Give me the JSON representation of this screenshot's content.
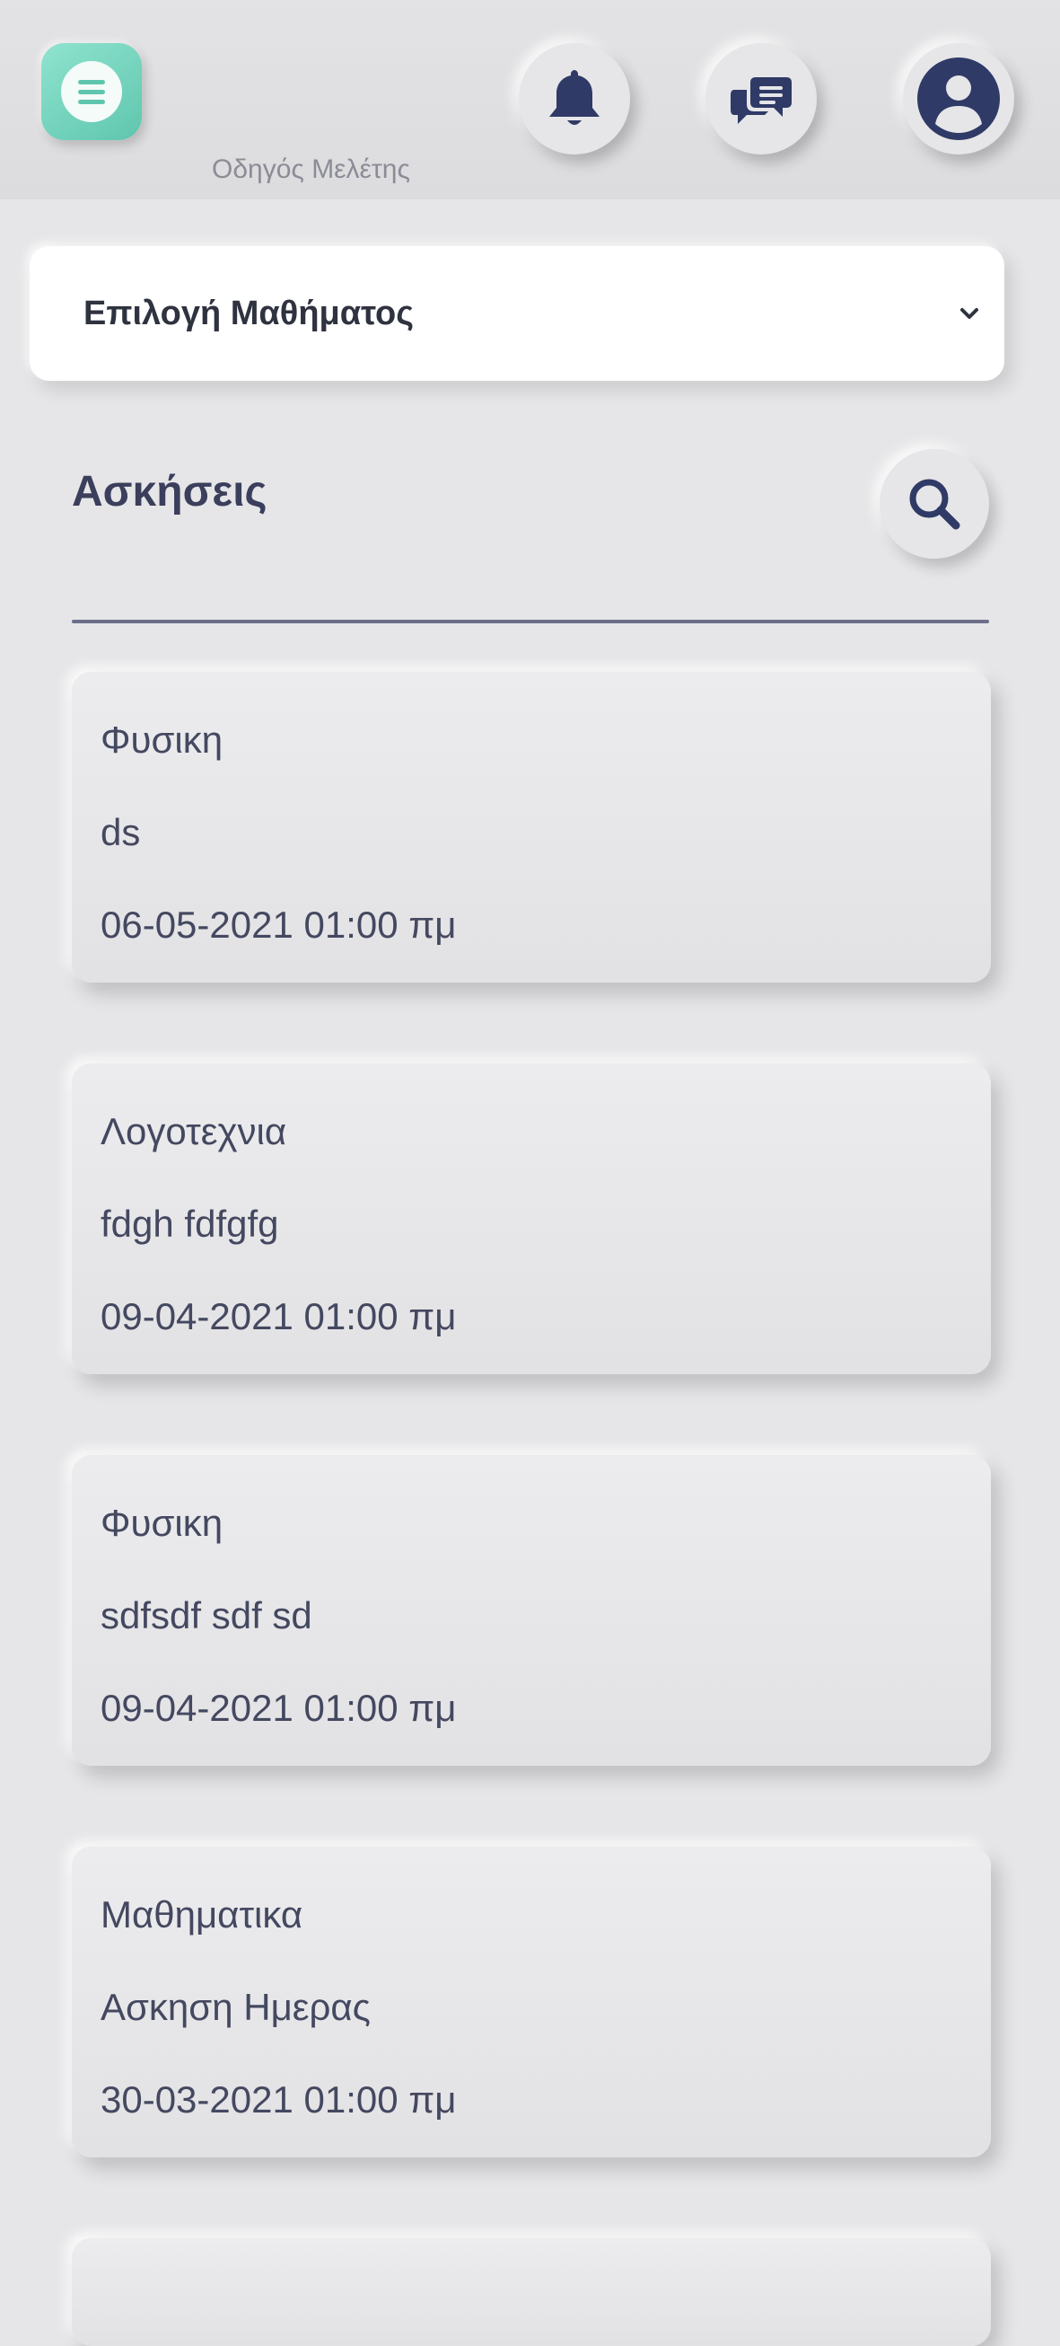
{
  "header": {
    "app_title": "Οδηγός Μελέτης",
    "icons": [
      "menu-icon",
      "bell-icon",
      "chat-icon",
      "user-icon"
    ],
    "accent_color": "#6fd3bb",
    "icon_color": "#2f3a66"
  },
  "course_select": {
    "label": "Επιλογή Μαθήματος"
  },
  "section": {
    "title": "Ασκήσεις"
  },
  "exercises": [
    {
      "subject": "Φυσικη",
      "title": "ds",
      "date": "06-05-2021 01:00 πμ"
    },
    {
      "subject": "Λογοτεχνια",
      "title": "fdgh fdfgfg",
      "date": "09-04-2021 01:00 πμ"
    },
    {
      "subject": "Φυσικη",
      "title": "sdfsdf sdf sd",
      "date": "09-04-2021 01:00 πμ"
    },
    {
      "subject": "Μαθηματικα",
      "title": "Ασκηση Ημερας",
      "date": "30-03-2021 01:00 πμ"
    }
  ]
}
